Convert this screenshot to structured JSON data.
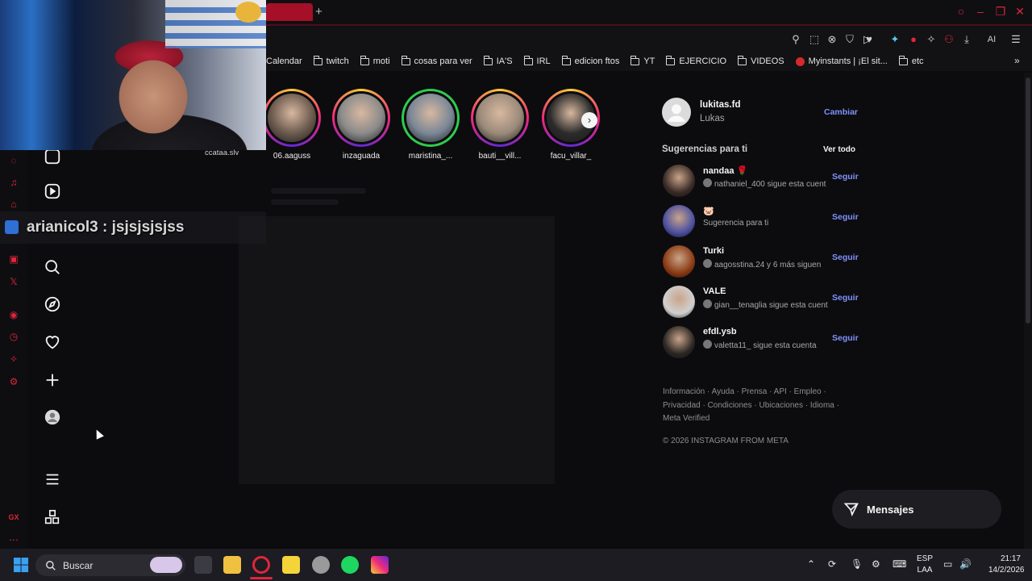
{
  "browser": {
    "bookmarks": [
      {
        "label": "Calendar",
        "icon": "none"
      },
      {
        "label": "twitch",
        "icon": "folder"
      },
      {
        "label": "moti",
        "icon": "folder"
      },
      {
        "label": "cosas para ver",
        "icon": "folder"
      },
      {
        "label": "IA'S",
        "icon": "folder"
      },
      {
        "label": "IRL",
        "icon": "folder"
      },
      {
        "label": "edicion ftos",
        "icon": "folder"
      },
      {
        "label": "YT",
        "icon": "folder"
      },
      {
        "label": "EJERCICIO",
        "icon": "folder"
      },
      {
        "label": "VIDEOS",
        "icon": "folder"
      },
      {
        "label": "Myinstants | ¡El sit...",
        "icon": "red-dot"
      },
      {
        "label": "etc",
        "icon": "folder"
      }
    ],
    "toolbar_ai_label": "AI",
    "accent_color": "#e0253b"
  },
  "stories": [
    {
      "username": "06.aaguss",
      "ring": "gradient",
      "color": "#6b5a4e"
    },
    {
      "username": "inzaguada",
      "ring": "gradient",
      "color": "#8a8a8a"
    },
    {
      "username": "maristina_...",
      "ring": "green",
      "color": "#7a8796"
    },
    {
      "username": "bauti__vill...",
      "ring": "gradient",
      "color": "#9a8a7a"
    },
    {
      "username": "facu_villar_",
      "ring": "gradient",
      "color": "#2b2b2b"
    }
  ],
  "overlay": {
    "streamer_partial_username": "ccataa.slv",
    "chat_message": "arianicol3 : jsjsjsjsjss"
  },
  "profile": {
    "username": "lukitas.fd",
    "full_name": "Lukas",
    "switch_label": "Cambiar"
  },
  "suggestions": {
    "title": "Sugerencias para ti",
    "see_all": "Ver todo",
    "follow_label": "Seguir",
    "items": [
      {
        "name": "nandaa 🌹",
        "subtitle": "nathaniel_400 sigue esta cuent",
        "avatar_color": "#3a2a26"
      },
      {
        "name": "🐷",
        "subtitle": "Sugerencia para ti",
        "avatar_color": "#4b4fa0"
      },
      {
        "name": "Turki",
        "subtitle": "aagosstina.24 y 6 más siguen",
        "avatar_color": "#8a3a12"
      },
      {
        "name": "VALE",
        "subtitle": "gian__tenaglia sigue esta cuent",
        "avatar_color": "#d0d0d0"
      },
      {
        "name": "efdl.ysb",
        "subtitle": "valetta11_ sigue esta cuenta",
        "avatar_color": "#2a2623"
      }
    ]
  },
  "footer": {
    "links_line1": "Información · Ayuda · Prensa · API · Empleo ·",
    "links_line2": "Privacidad · Condiciones · Ubicaciones · Idioma ·",
    "links_line3": "Meta Verified",
    "copyright": "© 2026 INSTAGRAM FROM META"
  },
  "messages": {
    "label": "Mensajes"
  },
  "taskbar": {
    "search_label": "Buscar",
    "language": "ESP",
    "layout": "LAA",
    "time": "21:17",
    "date": "14/2/2026"
  },
  "nav_icons": [
    "reels-icon",
    "video-icon",
    "search-icon",
    "explore-icon",
    "heart-icon",
    "create-icon",
    "profile-icon",
    "menu-icon",
    "apps-icon"
  ]
}
